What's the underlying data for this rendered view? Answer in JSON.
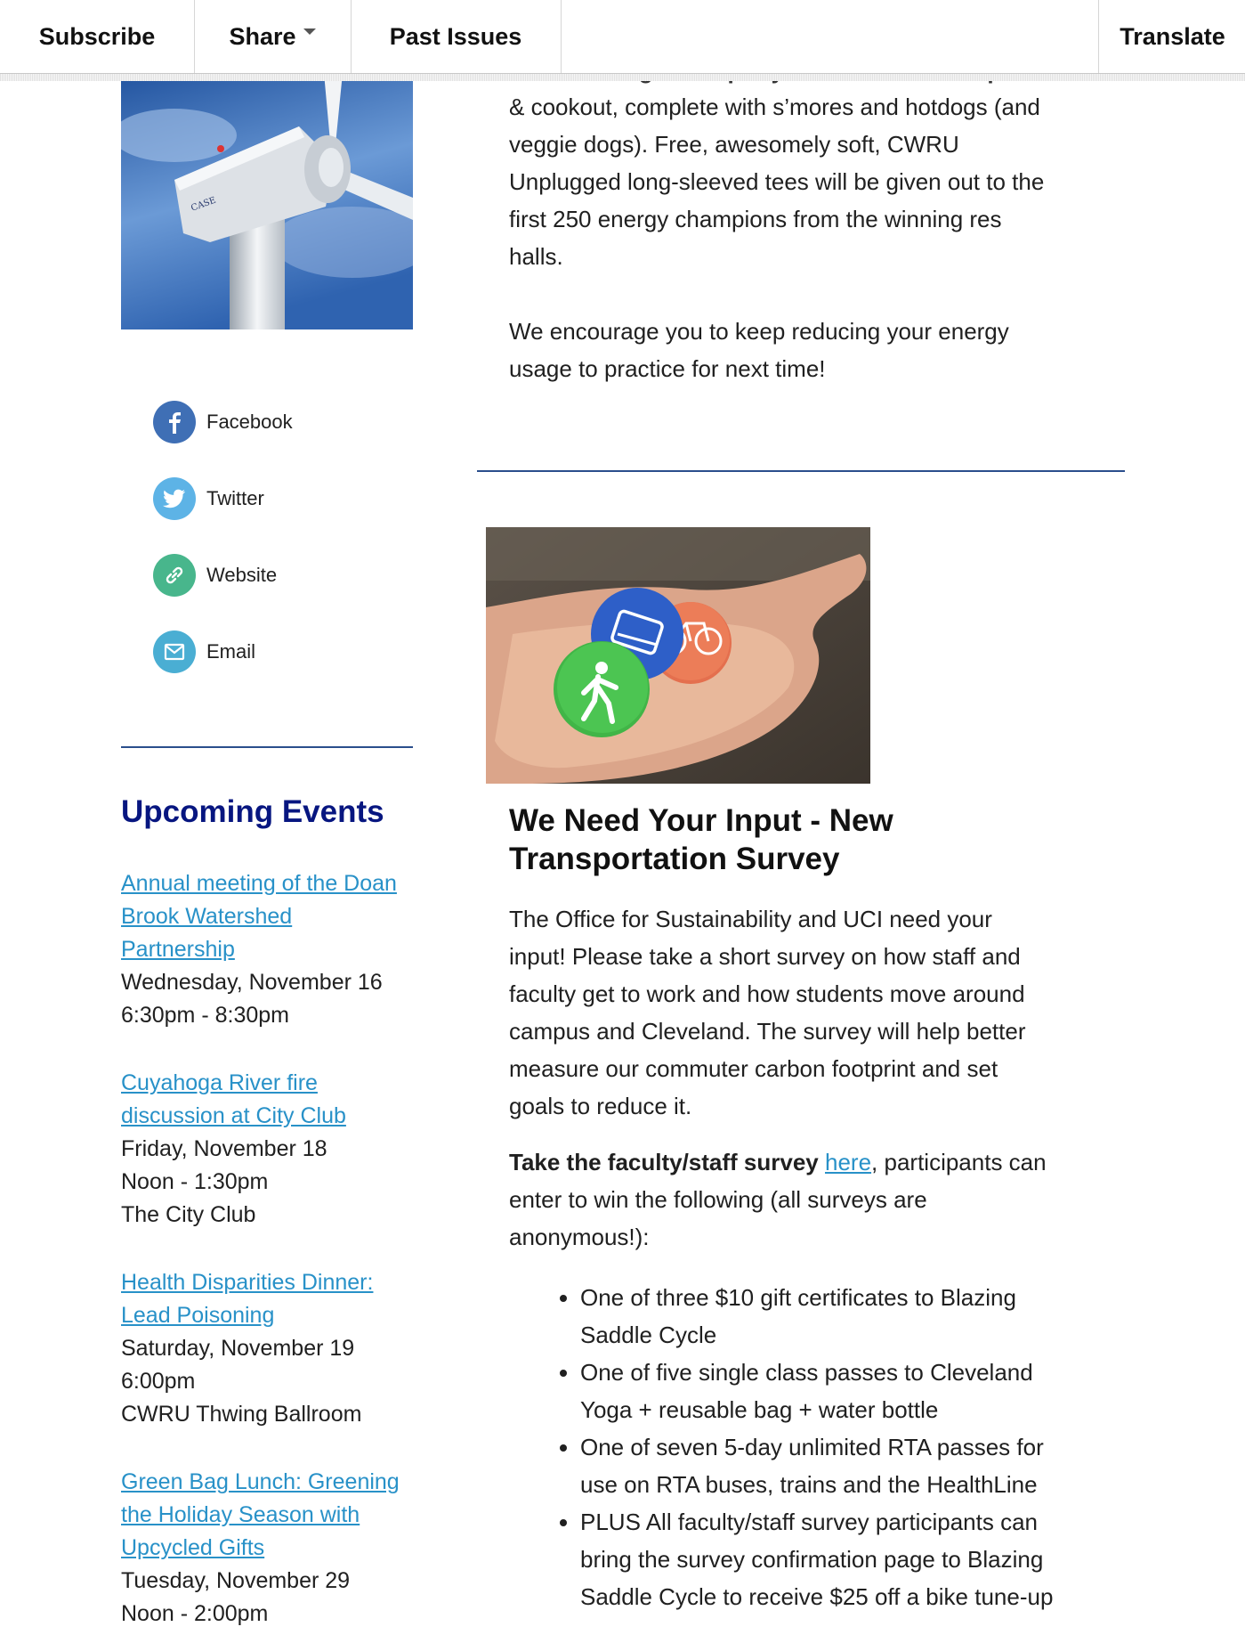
{
  "topbar": {
    "subscribe": "Subscribe",
    "share": "Share",
    "past_issues": "Past Issues",
    "translate": "Translate"
  },
  "article1": {
    "cut_line": "their winnings! The party will include a camp fire",
    "body_lines": [
      "& cookout, complete with s’mores and hotdogs (and",
      "veggie dogs). Free, awesomely soft, CWRU",
      "Unplugged long-sleeved tees will be given out to the",
      "first 250 energy champions from the winning res",
      "halls."
    ],
    "closing_lines": [
      "We encourage you to keep reducing your energy",
      "usage to practice for next time!"
    ]
  },
  "social": [
    {
      "label": "Facebook",
      "icon": "facebook-icon",
      "color": "#3f6fb5"
    },
    {
      "label": "Twitter",
      "icon": "twitter-icon",
      "color": "#5db3e6"
    },
    {
      "label": "Website",
      "icon": "link-icon",
      "color": "#48b68c"
    },
    {
      "label": "Email",
      "icon": "mail-icon",
      "color": "#4aaed3"
    }
  ],
  "events": {
    "title": "Upcoming Events",
    "items": [
      {
        "link_lines": [
          "Annual meeting of the Doan",
          "Brook Watershed",
          "Partnership"
        ],
        "details": [
          "Wednesday, November 16",
          "6:30pm - 8:30pm"
        ]
      },
      {
        "link_lines": [
          "Cuyahoga River fire",
          "discussion at City Club"
        ],
        "details": [
          "Friday, November 18",
          "Noon - 1:30pm",
          "The City Club"
        ]
      },
      {
        "link_lines": [
          "Health Disparities Dinner:",
          "Lead Poisoning"
        ],
        "details": [
          "Saturday, November 19",
          "6:00pm",
          "CWRU Thwing Ballroom"
        ]
      },
      {
        "link_lines": [
          "Green Bag Lunch: Greening",
          "the Holiday Season with",
          "Upcycled Gifts"
        ],
        "details": [
          "Tuesday, November 29",
          "Noon - 2:00pm"
        ]
      }
    ]
  },
  "article2": {
    "title_lines": [
      "We Need Your Input - New",
      "Transportation Survey"
    ],
    "intro_lines": [
      "The Office for Sustainability and UCI need your",
      "input! Please take a short survey on how staff and",
      "faculty get to work and how students move around",
      "campus and Cleveland. The survey will help better",
      "measure our commuter carbon footprint and set",
      "goals to reduce it."
    ],
    "cta_bold": "Take the faculty/staff survey",
    "cta_link": "here",
    "cta_rest_1": ", participants can",
    "cta_rest_lines": [
      "enter to win the following (all surveys are",
      "anonymous!):"
    ],
    "prizes": [
      [
        "One of three $10 gift certificates to Blazing",
        "Saddle Cycle"
      ],
      [
        "One of five single class passes to Cleveland",
        "Yoga + reusable bag + water bottle"
      ],
      [
        "One of seven 5-day unlimited RTA passes for",
        "use on RTA buses, trains and the HealthLine"
      ],
      [
        "PLUS All faculty/staff survey participants can",
        "bring the survey confirmation page to Blazing",
        "Saddle Cycle to receive $25 off a bike tune-up"
      ]
    ]
  }
}
